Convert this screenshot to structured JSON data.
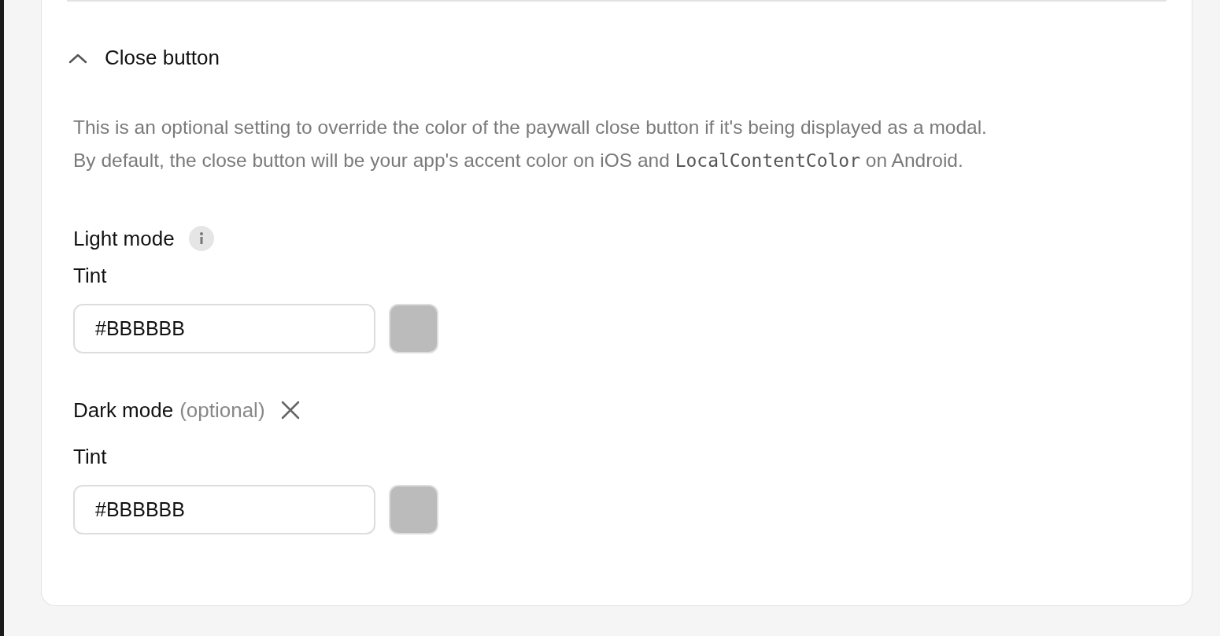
{
  "section": {
    "title": "Close button",
    "expanded": true,
    "description": [
      [
        {
          "kind": "text",
          "text": "This is an optional setting to override the color of the paywall close button if it's being displayed as a modal."
        }
      ],
      [
        {
          "kind": "text",
          "text": "By default, the close button will be your app's accent color on iOS and "
        },
        {
          "kind": "code",
          "text": "LocalContentColor"
        },
        {
          "kind": "text",
          "text": " on Android."
        }
      ]
    ],
    "modes": [
      {
        "label": "Light mode",
        "info": true,
        "field_label": "Tint",
        "value": "#BBBBBB",
        "color": "#bbbbbb"
      },
      {
        "label": "Dark mode",
        "optional": "(optional)",
        "removable": true,
        "field_label": "Tint",
        "value": "#BBBBBB",
        "color": "#bbbbbb"
      }
    ]
  }
}
